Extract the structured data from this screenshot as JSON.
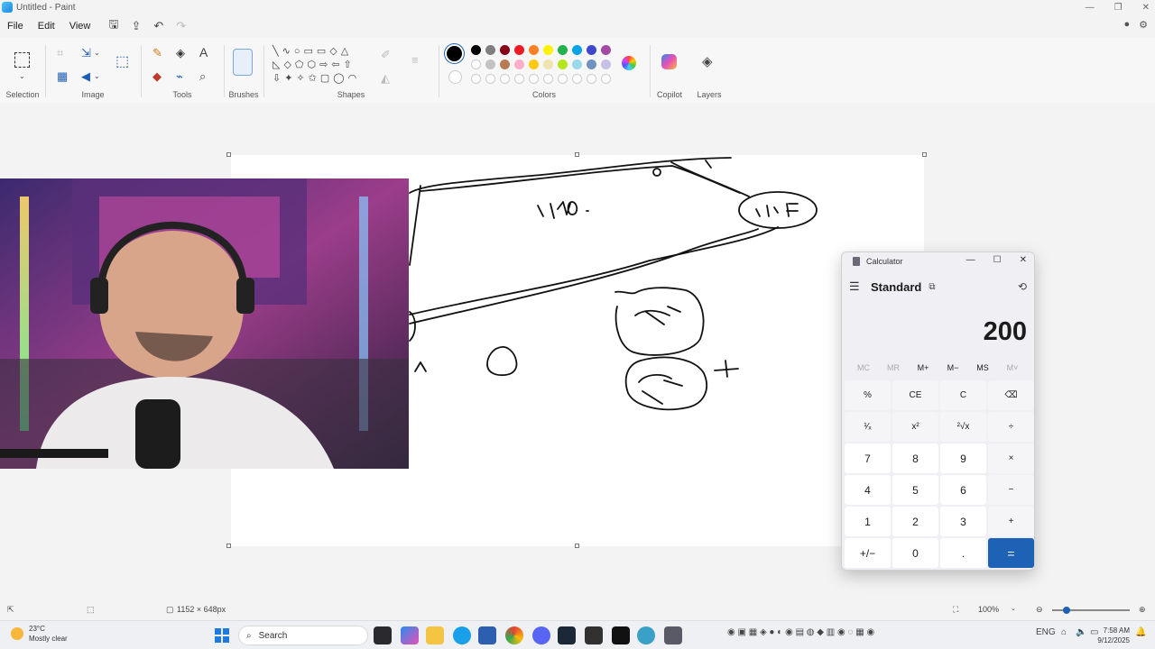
{
  "window": {
    "title": "Untitled - Paint",
    "controls": [
      "—",
      "❐",
      "✕"
    ]
  },
  "menu": {
    "items": [
      "File",
      "Edit",
      "View"
    ]
  },
  "ribbon": {
    "groups": [
      "Selection",
      "Image",
      "Tools",
      "Brushes",
      "Shapes",
      "Colors",
      "Copilot",
      "Layers"
    ],
    "colors": {
      "primary": "#000000",
      "row1": [
        "#000000",
        "#7f7f7f",
        "#880015",
        "#ed1c24",
        "#ff7f27",
        "#fff200",
        "#22b14c",
        "#00a2e8",
        "#3f48cc",
        "#a349a4"
      ],
      "row2": [
        "#ffffff",
        "#c3c3c3",
        "#b97a57",
        "#ffaec9",
        "#ffc90e",
        "#efe4b0",
        "#b5e61d",
        "#99d9ea",
        "#7092be",
        "#c8bfe7"
      ]
    }
  },
  "status": {
    "canvas_size": "1152 × 648px",
    "zoom": "100%"
  },
  "calculator": {
    "title": "Calculator",
    "mode": "Standard",
    "display": "200",
    "memory": [
      "MC",
      "MR",
      "M+",
      "M−",
      "MS",
      "M˅"
    ],
    "keys": [
      "%",
      "CE",
      "C",
      "⌫",
      "¹⁄ₓ",
      "x²",
      "²√x",
      "÷",
      "7",
      "8",
      "9",
      "×",
      "4",
      "5",
      "6",
      "−",
      "1",
      "2",
      "3",
      "+",
      "+/−",
      "0",
      ".",
      "="
    ]
  },
  "taskbar": {
    "weather_temp": "23°C",
    "weather_desc": "Mostly clear",
    "search_label": "Search",
    "language": "ENG",
    "time": "7:58 AM",
    "date": "9/12/2025"
  },
  "icons": {
    "accent": "#1e62b6"
  }
}
